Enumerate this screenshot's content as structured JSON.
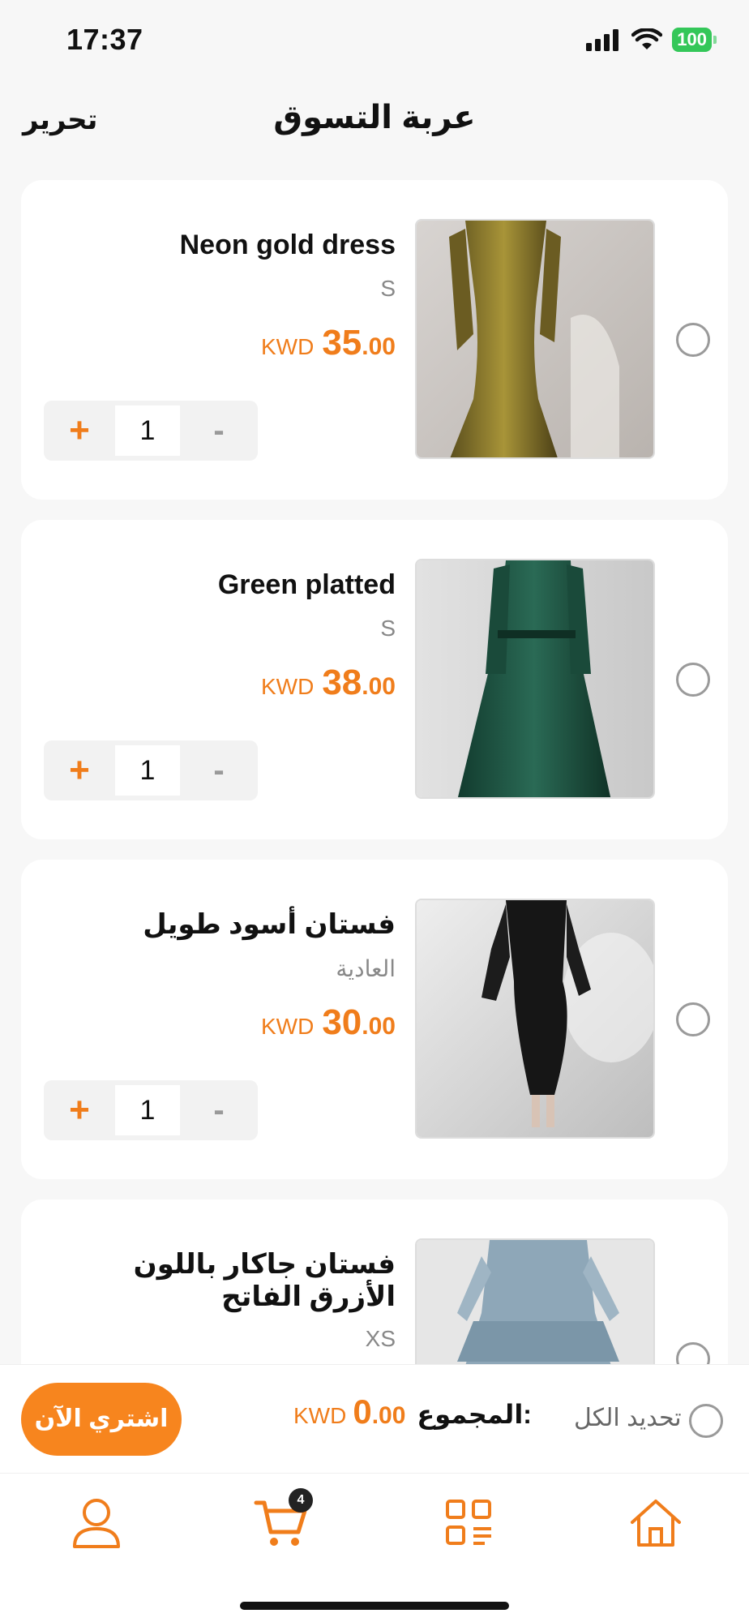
{
  "status_bar": {
    "time": "17:37",
    "battery": "100"
  },
  "header": {
    "title": "عربة التسوق",
    "edit_label": "تحرير"
  },
  "cart_items": [
    {
      "title": "Neon gold dress",
      "variant": "S",
      "currency": "KWD",
      "price_int": "35",
      "price_dec": ".00",
      "quantity": "1",
      "plus": "+",
      "minus": "-"
    },
    {
      "title": "Green platted",
      "variant": "S",
      "currency": "KWD",
      "price_int": "38",
      "price_dec": ".00",
      "quantity": "1",
      "plus": "+",
      "minus": "-"
    },
    {
      "title": "فستان أسود طويل",
      "variant": "العادية",
      "currency": "KWD",
      "price_int": "30",
      "price_dec": ".00",
      "quantity": "1",
      "plus": "+",
      "minus": "-"
    },
    {
      "title": "فستان جاكار باللون الأزرق الفاتح",
      "variant": "XS"
    }
  ],
  "checkout": {
    "buy_label": "اشتري الآن",
    "total_label": "المجموع:",
    "total_currency": "KWD",
    "total_int": "0",
    "total_dec": ".00",
    "select_all_label": "تحديد الكل"
  },
  "tab_bar": {
    "cart_badge": "4",
    "icons": [
      "profile-icon",
      "cart-icon",
      "categories-icon",
      "home-icon"
    ],
    "accent": "#f07d1b"
  }
}
